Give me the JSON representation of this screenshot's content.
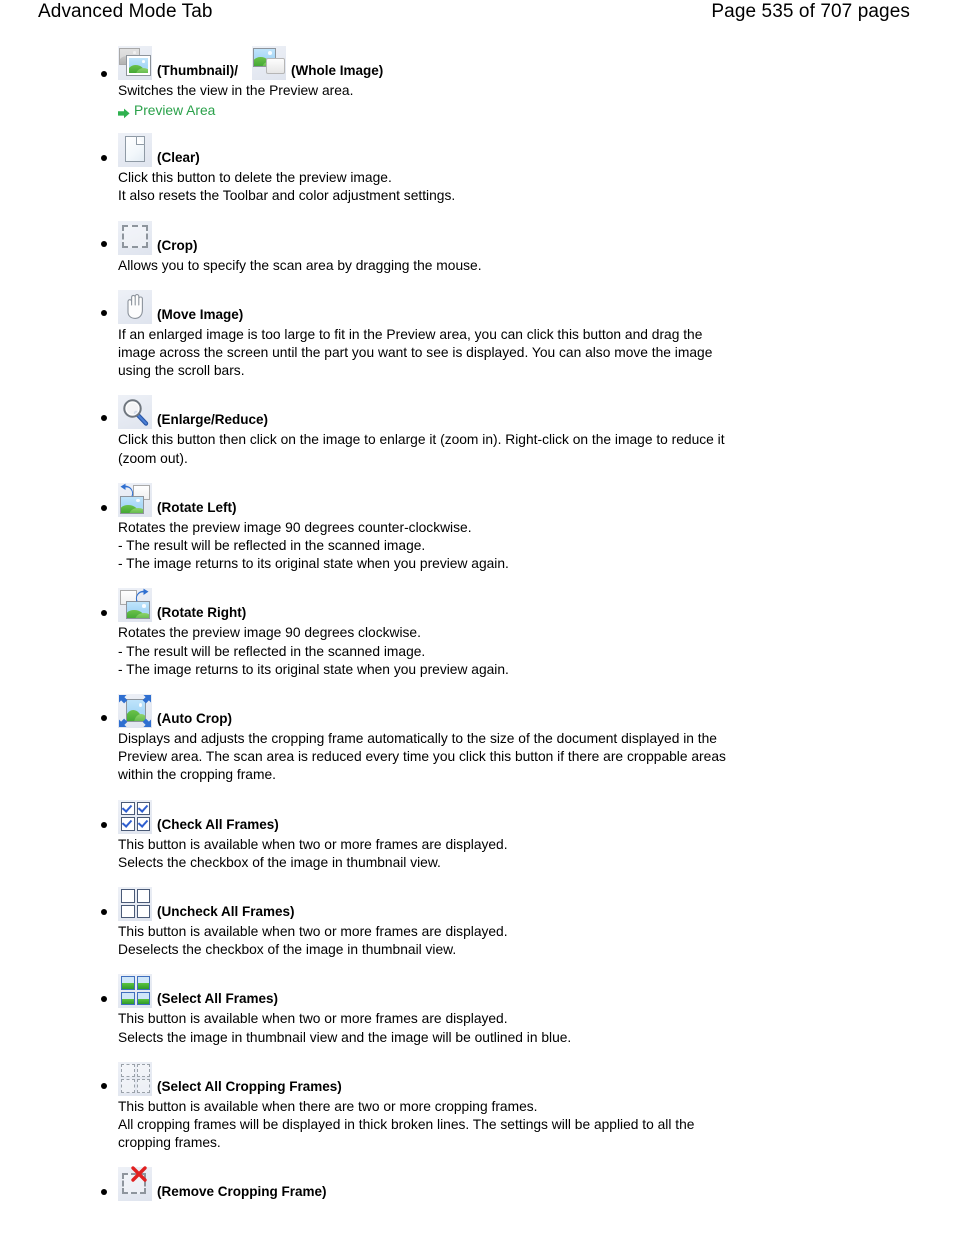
{
  "header": {
    "title": "Advanced Mode Tab",
    "page_label": "Page 535 of 707 pages"
  },
  "items": [
    {
      "icons": [
        "thumbnail-icon",
        "whole-image-icon"
      ],
      "label_1": "(Thumbnail)/",
      "label_2": "(Whole Image)",
      "desc": "Switches the view in the Preview area.",
      "link": "Preview Area"
    },
    {
      "icons": [
        "clear-icon"
      ],
      "label": "(Clear)",
      "desc_line_1": "Click this button to delete the preview image.",
      "desc_line_2": "It also resets the Toolbar and color adjustment settings."
    },
    {
      "icons": [
        "crop-icon"
      ],
      "label": "(Crop)",
      "desc": "Allows you to specify the scan area by dragging the mouse."
    },
    {
      "icons": [
        "move-image-icon"
      ],
      "label": "(Move Image)",
      "desc": "If an enlarged image is too large to fit in the Preview area, you can click this button and drag the image across the screen until the part you want to see is displayed. You can also move the image using the scroll bars."
    },
    {
      "icons": [
        "magnifier-icon"
      ],
      "label": "(Enlarge/Reduce)",
      "desc": "Click this button then click on the image to enlarge it (zoom in). Right-click on the image to reduce it (zoom out)."
    },
    {
      "icons": [
        "rotate-left-icon"
      ],
      "label": "(Rotate Left)",
      "desc_line_1": "Rotates the preview image 90 degrees counter-clockwise.",
      "desc_line_2": "- The result will be reflected in the scanned image.",
      "desc_line_3": "- The image returns to its original state when you preview again."
    },
    {
      "icons": [
        "rotate-right-icon"
      ],
      "label": "(Rotate Right)",
      "desc_line_1": "Rotates the preview image 90 degrees clockwise.",
      "desc_line_2": "- The result will be reflected in the scanned image.",
      "desc_line_3": "- The image returns to its original state when you preview again."
    },
    {
      "icons": [
        "auto-crop-icon"
      ],
      "label": "(Auto Crop)",
      "desc": "Displays and adjusts the cropping frame automatically to the size of the document displayed in the Preview area. The scan area is reduced every time you click this button if there are croppable areas within the cropping frame."
    },
    {
      "icons": [
        "check-all-frames-icon"
      ],
      "label": "(Check All Frames)",
      "desc_line_1": "This button is available when two or more frames are displayed.",
      "desc_line_2": "Selects the checkbox of the image in thumbnail view."
    },
    {
      "icons": [
        "uncheck-all-frames-icon"
      ],
      "label": "(Uncheck All Frames)",
      "desc_line_1": "This button is available when two or more frames are displayed.",
      "desc_line_2": "Deselects the checkbox of the image in thumbnail view."
    },
    {
      "icons": [
        "select-all-frames-icon"
      ],
      "label": "(Select All Frames)",
      "desc_line_1": "This button is available when two or more frames are displayed.",
      "desc_line_2": "Selects the image in thumbnail view and the image will be outlined in blue."
    },
    {
      "icons": [
        "select-all-cropping-frames-icon"
      ],
      "label": "(Select All Cropping Frames)",
      "desc_line_1": "This button is available when there are two or more cropping frames.",
      "desc_line_2": "All cropping frames will be displayed in thick broken lines. The settings will be applied to all the cropping frames."
    },
    {
      "icons": [
        "remove-cropping-frame-icon"
      ],
      "label": "(Remove Cropping Frame)"
    }
  ],
  "colors": {
    "link_green": "#2aa14a",
    "text": "#000000",
    "background": "#ffffff"
  }
}
